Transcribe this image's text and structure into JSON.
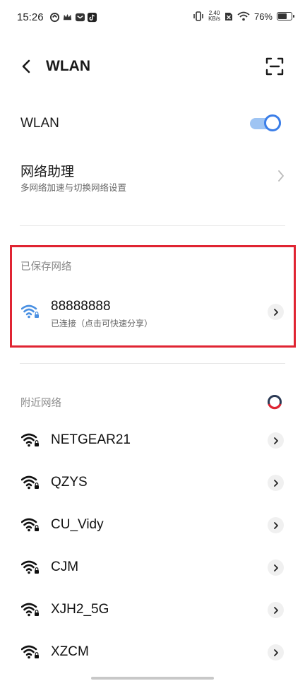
{
  "status_bar": {
    "time": "15:26",
    "speed_value": "2.40",
    "speed_unit": "KB/s",
    "battery": "76%"
  },
  "header": {
    "title": "WLAN"
  },
  "wlan_toggle": {
    "label": "WLAN",
    "on": true
  },
  "assistant": {
    "title": "网络助理",
    "subtitle": "多网络加速与切换网络设置"
  },
  "saved_networks": {
    "section_title": "已保存网络",
    "items": [
      {
        "name": "88888888",
        "status": "已连接（点击可快速分享）"
      }
    ]
  },
  "nearby_networks": {
    "section_title": "附近网络",
    "items": [
      {
        "name": "NETGEAR21"
      },
      {
        "name": "QZYS"
      },
      {
        "name": "CU_Vidy"
      },
      {
        "name": "CJM"
      },
      {
        "name": "XJH2_5G"
      },
      {
        "name": "XZCM"
      }
    ]
  },
  "colors": {
    "accent": "#3b7ee8",
    "highlight_border": "#e02432"
  },
  "icons": [
    "back-arrow-icon",
    "scan-icon",
    "wifi-icon",
    "chevron-right-icon",
    "loading-spinner-icon"
  ]
}
